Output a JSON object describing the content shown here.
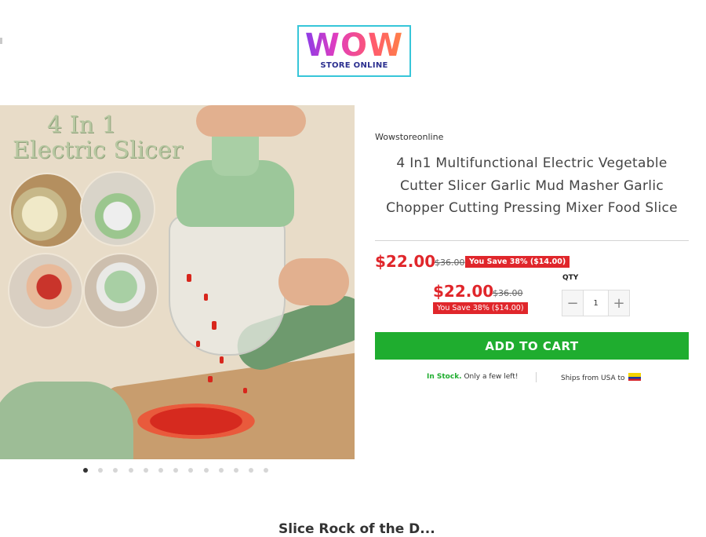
{
  "logo": {
    "main": "WOW",
    "sub": "STORE ONLINE"
  },
  "gallery": {
    "image_text_line1": "4 In 1",
    "image_text_line2": "Electric Slicer",
    "dots_total": 13,
    "active_index": 0
  },
  "product": {
    "vendor": "Wowstoreonline",
    "title": "4 In1 Multifunctional Electric Vegetable Cutter Slicer Garlic Mud Masher Garlic Chopper Cutting Pressing Mixer Food Slice",
    "price": "$22.00",
    "compare_price": "$36.00",
    "savings": "You Save 38% ($14.00)",
    "price_secondary": "$22.00",
    "compare_price_secondary": "$36.00",
    "savings_secondary": "You Save 38% ($14.00)"
  },
  "quantity": {
    "label": "QTY",
    "value": "1",
    "minus": "−",
    "plus": "+"
  },
  "cart_button": "ADD TO CART",
  "stock": {
    "status": "In Stock.",
    "note": " Only a few left!"
  },
  "shipping": {
    "text": "Ships from USA to",
    "flag_icon": "flag-icon"
  },
  "colors": {
    "accent_red": "#e0262b",
    "cart_green": "#1fad2f"
  },
  "bottom": {
    "partial_heading": "Slice Rock of the D..."
  }
}
